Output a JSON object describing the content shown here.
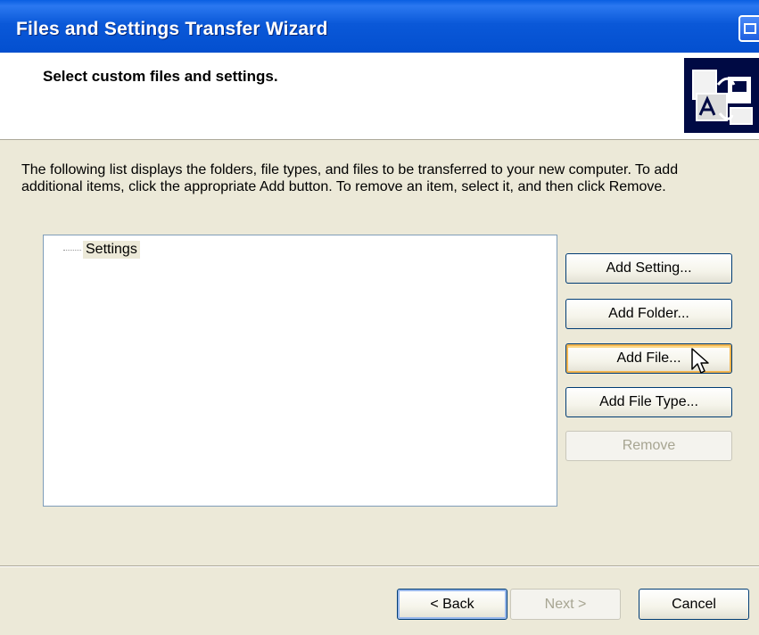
{
  "window": {
    "title": "Files and Settings Transfer Wizard"
  },
  "header": {
    "title": "Select custom files and settings.",
    "logo_icon": "wizard-logo-icon"
  },
  "body": {
    "description": "The following list displays the folders, file types, and files to be transferred to your new computer. To add additional items, click the appropriate Add button. To remove an item, select it, and then click Remove.",
    "list_items": [
      "Settings"
    ]
  },
  "buttons": {
    "add_setting": "Add Setting...",
    "add_folder": "Add Folder...",
    "add_file": "Add File...",
    "add_file_type": "Add File Type...",
    "remove": "Remove"
  },
  "footer": {
    "back": "< Back",
    "next": "Next >",
    "cancel": "Cancel"
  },
  "colors": {
    "titlebar": "#0a58d8",
    "dialog_bg": "#ece9d8",
    "header_bg": "#ffffff",
    "button_border": "#003c74",
    "hover_highlight": "#f3b54f"
  }
}
